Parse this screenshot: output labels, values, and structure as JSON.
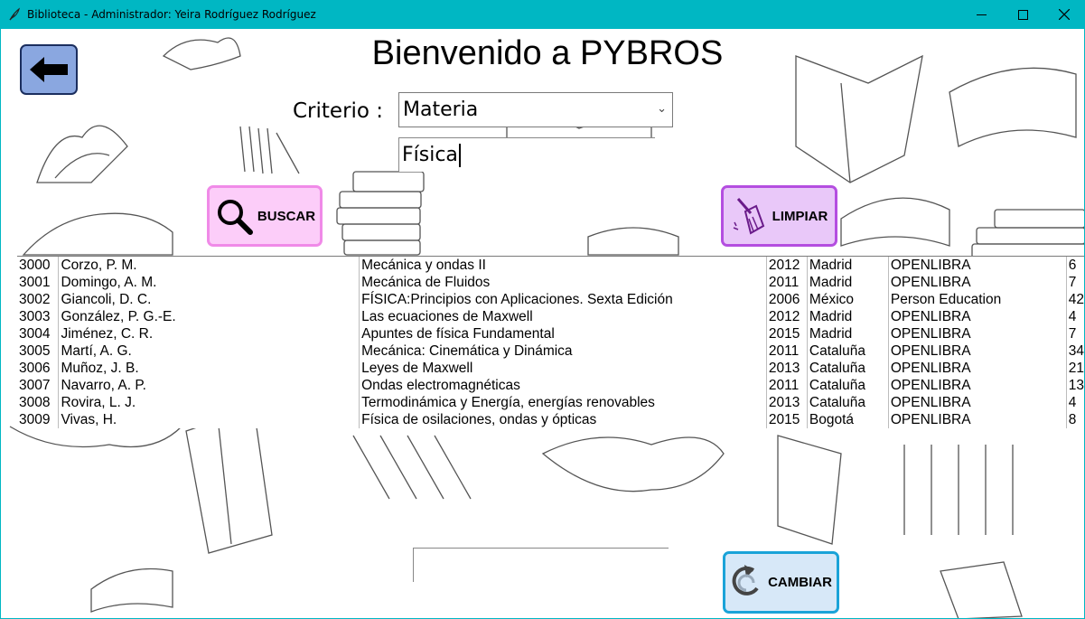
{
  "window": {
    "title": "Biblioteca - Administrador: Yeira Rodríguez Rodríguez",
    "controls": [
      "minimize-icon",
      "maximize-icon",
      "close-icon"
    ]
  },
  "header": {
    "title": "Bienvenido a PYBROS"
  },
  "search": {
    "criterio_label": "Criterio :",
    "criterio_value": "Materia",
    "query_value": "Física"
  },
  "buttons": {
    "buscar": "BUSCAR",
    "limpiar": "LIMPIAR",
    "cambiar": "CAMBIAR"
  },
  "bottom_input_value": "",
  "results": [
    [
      "3000",
      "Corzo, P. M.",
      "Mecánica y ondas II",
      "2012",
      "Madrid",
      "OPENLIBRA",
      "6"
    ],
    [
      "3001",
      "Domingo, A. M.",
      "Mecánica de Fluidos",
      "2011",
      "Madrid",
      "OPENLIBRA",
      "7"
    ],
    [
      "3002",
      "Giancoli, D. C.",
      "FÍSICA:Principios con Aplicaciones. Sexta Edición",
      "2006",
      "México",
      "Person Education",
      "42"
    ],
    [
      "3003",
      "González, P. G.-E.",
      "Las ecuaciones de Maxwell",
      "2012",
      "Madrid",
      "OPENLIBRA",
      "4"
    ],
    [
      "3004",
      "Jiménez, C. R.",
      "Apuntes de física Fundamental",
      " 2015",
      "Madrid",
      "OPENLIBRA",
      "7"
    ],
    [
      "3005",
      "Martí, A. G.",
      "Mecánica: Cinemática y Dinámica",
      " 2011",
      "Cataluña",
      "OPENLIBRA",
      "34"
    ],
    [
      "3006",
      "Muñoz, J. B.",
      "Leyes de Maxwell",
      "2013",
      "Cataluña",
      "OPENLIBRA",
      "21"
    ],
    [
      "3007",
      "Navarro, A. P.",
      "Ondas electromagnéticas",
      " 2011",
      "Cataluña",
      "OPENLIBRA",
      "13"
    ],
    [
      "3008",
      "Rovira, L. J.",
      "Termodinámica y Energía, energías renovables",
      "2013",
      "Cataluña",
      "OPENLIBRA",
      "4"
    ],
    [
      "3009",
      "Vivas, H.",
      "Física de osilaciones, ondas y ópticas",
      "2015",
      "Bogotá",
      "OPENLIBRA",
      "8"
    ]
  ],
  "colors": {
    "titlebar": "#00b7c3",
    "back_button": "#8aa7e0",
    "buscar_button": "#fccdf9",
    "limpiar_button": "#e9c8f9",
    "cambiar_button": "#d7e8f8"
  }
}
